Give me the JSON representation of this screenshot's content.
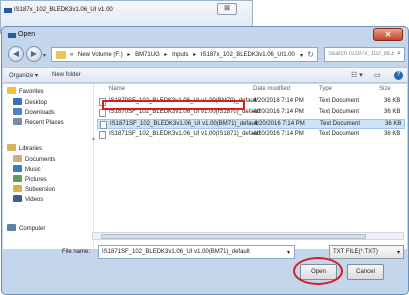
{
  "background_window": {
    "title": "IS187x_102_BLEDK3v1.06_UI v1.00",
    "close": "⊠"
  },
  "dialog": {
    "title": "Open",
    "close": "✕"
  },
  "nav": {
    "back": "◀",
    "forward": "▶",
    "dropdown": "▾",
    "path": [
      "«",
      "New Volume (F:)",
      "▸",
      "BM71UG",
      "▸",
      "Inputs",
      "▸",
      "IS187x_102_BLEDK3v1.06_UI1.00"
    ],
    "refresh": "↻",
    "search_placeholder": "Search IS187x_102_BLEDK3v1.0...",
    "search_icon": "⌕"
  },
  "toolbar": {
    "organize": "Organize ▾",
    "new_folder": "New folder",
    "views_icon": "☷ ▾",
    "preview_icon": "▭",
    "help_icon": "?"
  },
  "sidebar": {
    "favorites": {
      "label": "Favorites",
      "items": [
        "Desktop",
        "Downloads",
        "Recent Places"
      ]
    },
    "libraries": {
      "label": "Libraries",
      "items": [
        "Documents",
        "Music",
        "Pictures",
        "Subversion",
        "Videos"
      ]
    },
    "computer": "Computer"
  },
  "columns": {
    "name": "Name",
    "date": "Date modified",
    "type": "Type",
    "size": "Size"
  },
  "files": [
    {
      "name": "IS1870SF_102_BLEDK3v1.06_UI v1.00(BM70)_default",
      "date": "4/20/2016 7:14 PM",
      "type": "Text Document",
      "size": "36 KB"
    },
    {
      "name": "IS1870SF_102_BLEDK3v1.06_UI v1.00(IS1870)_default",
      "date": "4/20/2016 7:14 PM",
      "type": "Text Document",
      "size": "36 KB"
    },
    {
      "name": "IS1871SF_102_BLEDK3v1.06_UI v1.00(BM71)_default",
      "date": "4/20/2016 7:14 PM",
      "type": "Text Document",
      "size": "36 KB"
    },
    {
      "name": "IS1871SF_102_BLEDK3v1.06_UI v1.00(IS1871)_default",
      "date": "4/20/2016 7:14 PM",
      "type": "Text Document",
      "size": "36 KB"
    }
  ],
  "bottom": {
    "file_name_label": "File name:",
    "file_name_value": "IS1871SF_102_BLEDK3v1.06_UI v1.00(BM71)_default",
    "file_type_value": "TXT FILE(*.TXT)",
    "open_label": "Open",
    "cancel_label": "Cancel"
  },
  "colors": {
    "highlight": "#d61f1f",
    "selection": "#cce4f9",
    "close": "#c7432b"
  }
}
